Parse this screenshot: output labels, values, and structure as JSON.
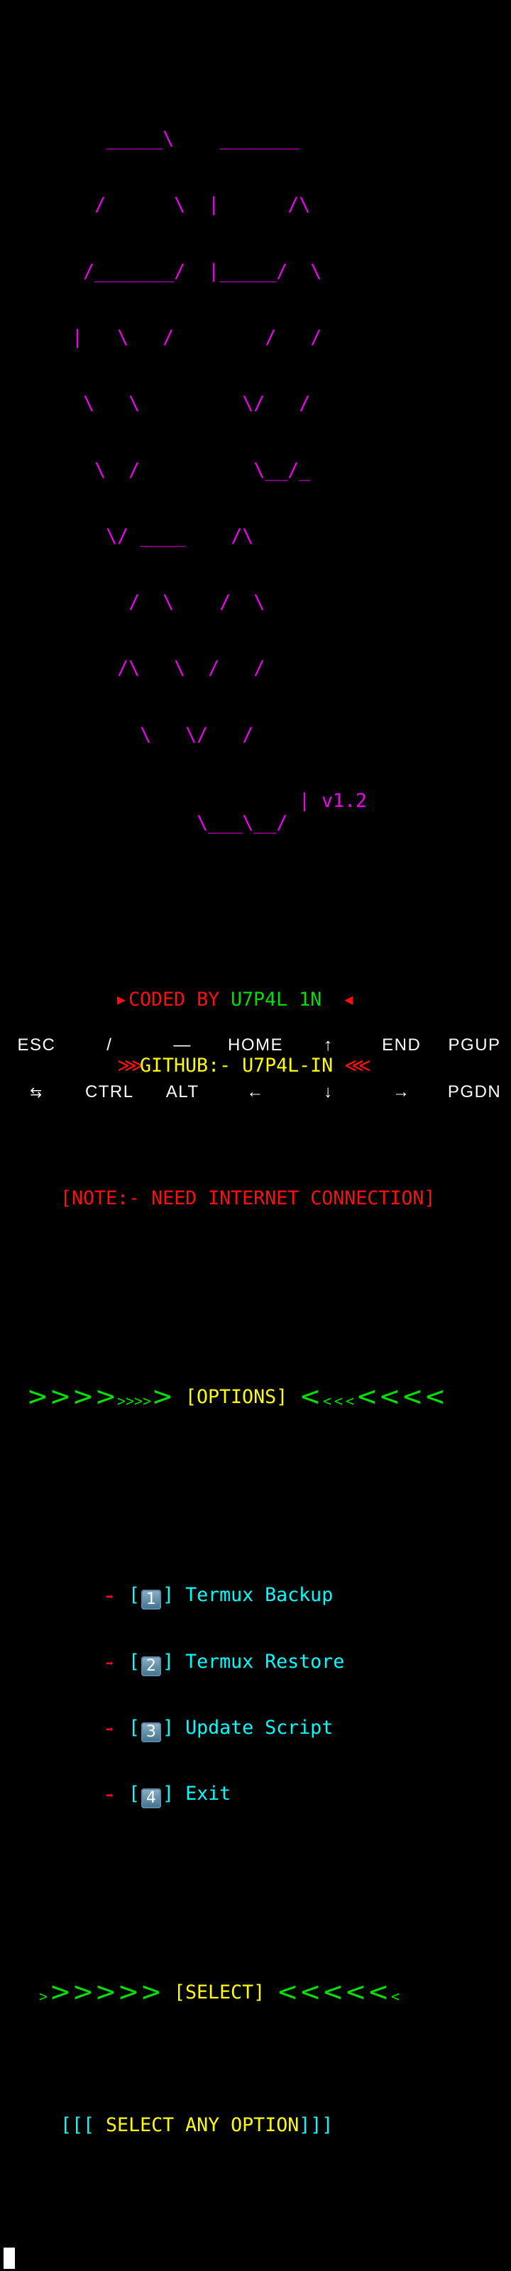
{
  "banner": {
    "art": [
      "         _____\\    _______",
      "        /      \\  |      /\\",
      "       /_______/  |_____/  \\",
      "      |   \\   /        /   /",
      "       \\   \\         \\/   /",
      "        \\  /          \\__/_",
      "         \\/ ____    /\\",
      "           /  \\    /  \\",
      "          /\\   \\  /   /",
      "            \\   \\/   /",
      "             \\___\\__/"
    ],
    "version": "| v1.2"
  },
  "credits": {
    "coded_prefix": "▶",
    "coded_by": "CODED BY ",
    "author": "U7P4L 1N",
    "coded_suffix": "◀",
    "github_prefix": "⋙",
    "github": "GITHUB:- U7P4L-IN",
    "github_suffix": "⋘"
  },
  "note": "[NOTE:- NEED INTERNET CONNECTION]",
  "options_header": "[OPTIONS]",
  "menu": [
    {
      "bracket_open": "[",
      "number": "1",
      "bracket_close": "]",
      "label": "Termux Backup"
    },
    {
      "bracket_open": "[",
      "number": "2",
      "bracket_close": "]",
      "label": "Termux Restore"
    },
    {
      "bracket_open": "[",
      "number": "3",
      "bracket_close": "]",
      "label": "Update Script"
    },
    {
      "bracket_open": "[",
      "number": "4",
      "bracket_close": "]",
      "label": "Exit"
    }
  ],
  "select_header": "[SELECT]",
  "prompt": {
    "open": "[[[ ",
    "text": "SELECT ANY OPTION",
    "close": "]]]"
  },
  "extra_keys": {
    "row1": [
      "ESC",
      "/",
      "―",
      "HOME",
      "↑",
      "END",
      "PGUP"
    ],
    "row2": [
      "⇆",
      "CTRL",
      "ALT",
      "←",
      "↓",
      "→",
      "PGDN"
    ]
  },
  "colors": {
    "magenta": "#ee00ee",
    "red": "#ff1010",
    "green": "#00dd00",
    "yellow": "#ffff00",
    "cyan": "#00ffff"
  }
}
